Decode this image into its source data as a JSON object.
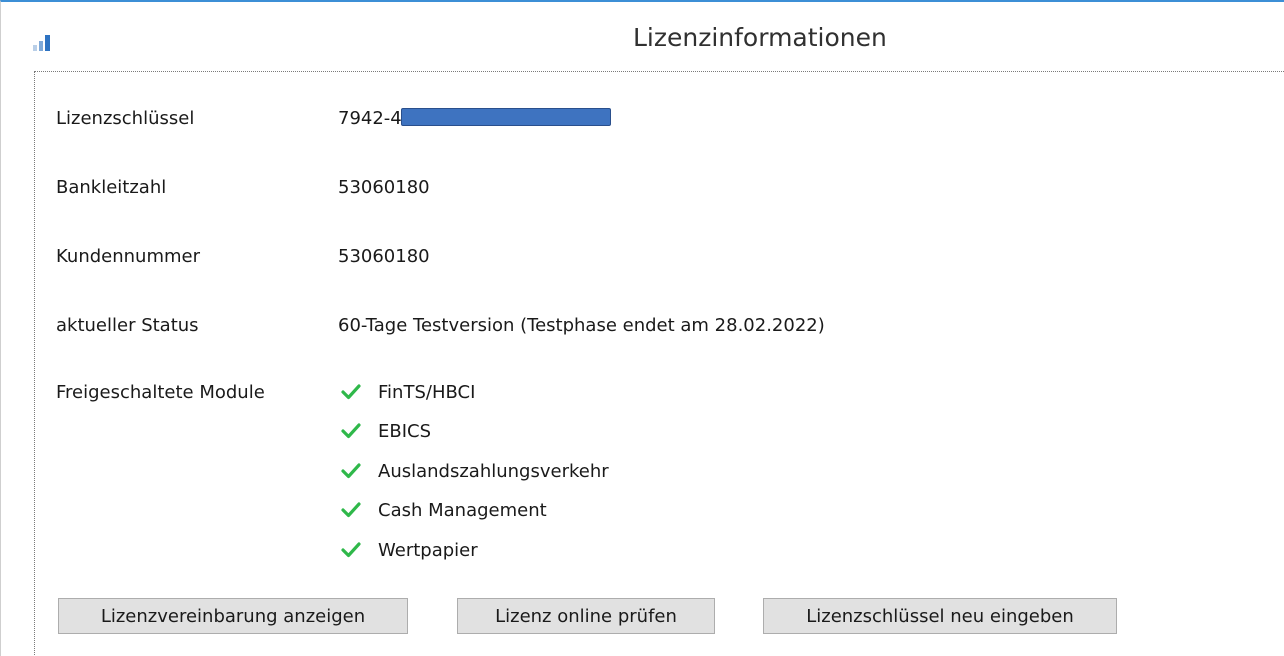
{
  "window": {
    "title": "Lizenzinformationen"
  },
  "fields": {
    "license_key_label": "Lizenzschlüssel",
    "license_key_value": "7942-4",
    "bank_code_label": "Bankleitzahl",
    "bank_code_value": "53060180",
    "customer_number_label": "Kundennummer",
    "customer_number_value": "53060180",
    "status_label": "aktueller Status",
    "status_value": "60-Tage Testversion (Testphase endet am 28.02.2022)",
    "modules_label": "Freigeschaltete Module"
  },
  "modules": [
    {
      "label": "FinTS/HBCI",
      "icon": "check-icon"
    },
    {
      "label": "EBICS",
      "icon": "check-icon"
    },
    {
      "label": "Auslandszahlungsverkehr",
      "icon": "check-icon"
    },
    {
      "label": "Cash Management",
      "icon": "check-icon"
    },
    {
      "label": "Wertpapier",
      "icon": "check-icon"
    }
  ],
  "buttons": {
    "show_agreement": "Lizenzvereinbarung anzeigen",
    "check_online": "Lizenz online prüfen",
    "reenter_key": "Lizenzschlüssel neu eingeben"
  },
  "colors": {
    "accent": "#3c8fd6",
    "check": "#2fb84a",
    "redaction": "#3e73c0",
    "button_bg": "#e1e1e1"
  }
}
